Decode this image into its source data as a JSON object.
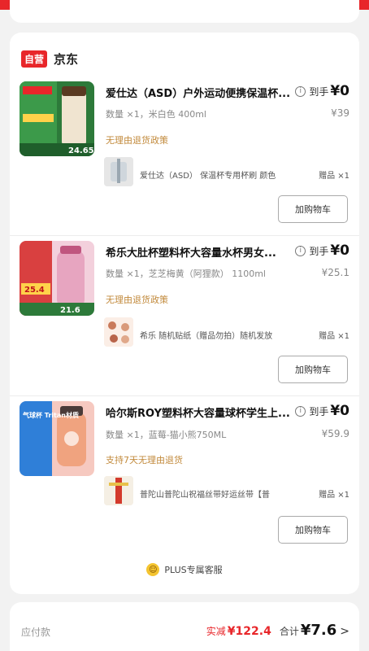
{
  "shop": {
    "badge": "自营",
    "name": "京东"
  },
  "items": [
    {
      "title": "爱仕达（ASD）户外运动便携保温杯...",
      "info_label": "到手",
      "price": "¥0",
      "spec": "数量 ×1，米白色 400ml",
      "orig_price": "¥39",
      "promo": "无理由退货政策",
      "gift_text": "爱仕达（ASD） 保温杯专用杯刷 颜色",
      "gift_qty": "赠品 ×1",
      "button": "加购物车",
      "thumb_label": "24.65",
      "thumb_colors": [
        "#2d7a3a",
        "#f0e4d0"
      ]
    },
    {
      "title": "希乐大肚杯塑料杯大容量水杯男女...",
      "info_label": "到手",
      "price": "¥0",
      "spec": "数量 ×1，芝芝梅黄（阿狸款） 1100ml",
      "orig_price": "¥25.1",
      "promo": "无理由退货政策",
      "gift_text": "希乐 随机贴纸（赠品勿拍）随机发放",
      "gift_qty": "赠品 ×1",
      "button": "加购物车",
      "thumb_label": "21.6",
      "thumb_label2": "25.4",
      "thumb_colors": [
        "#d94040",
        "#f3d0dc"
      ]
    },
    {
      "title": "哈尔斯ROY塑料杯大容量球杯学生上...",
      "info_label": "到手",
      "price": "¥0",
      "spec": "数量 ×1，蓝莓-猫小熊750ML",
      "orig_price": "¥59.9",
      "promo": "支持7天无理由退货",
      "gift_text": "普陀山普陀山祝福丝带好运丝带【普",
      "gift_qty": "赠品 ×1",
      "button": "加购物车",
      "thumb_label": "气球杯 Tritan材质",
      "thumb_colors": [
        "#2f7fd8",
        "#f6c9c0"
      ]
    }
  ],
  "plus_service": "PLUS专属客服",
  "footer": {
    "left_label": "应付款",
    "discount_label": "实减",
    "discount_value": "¥122.4",
    "total_label": "合计",
    "total_value": "¥7.6",
    "chevron": ">"
  }
}
